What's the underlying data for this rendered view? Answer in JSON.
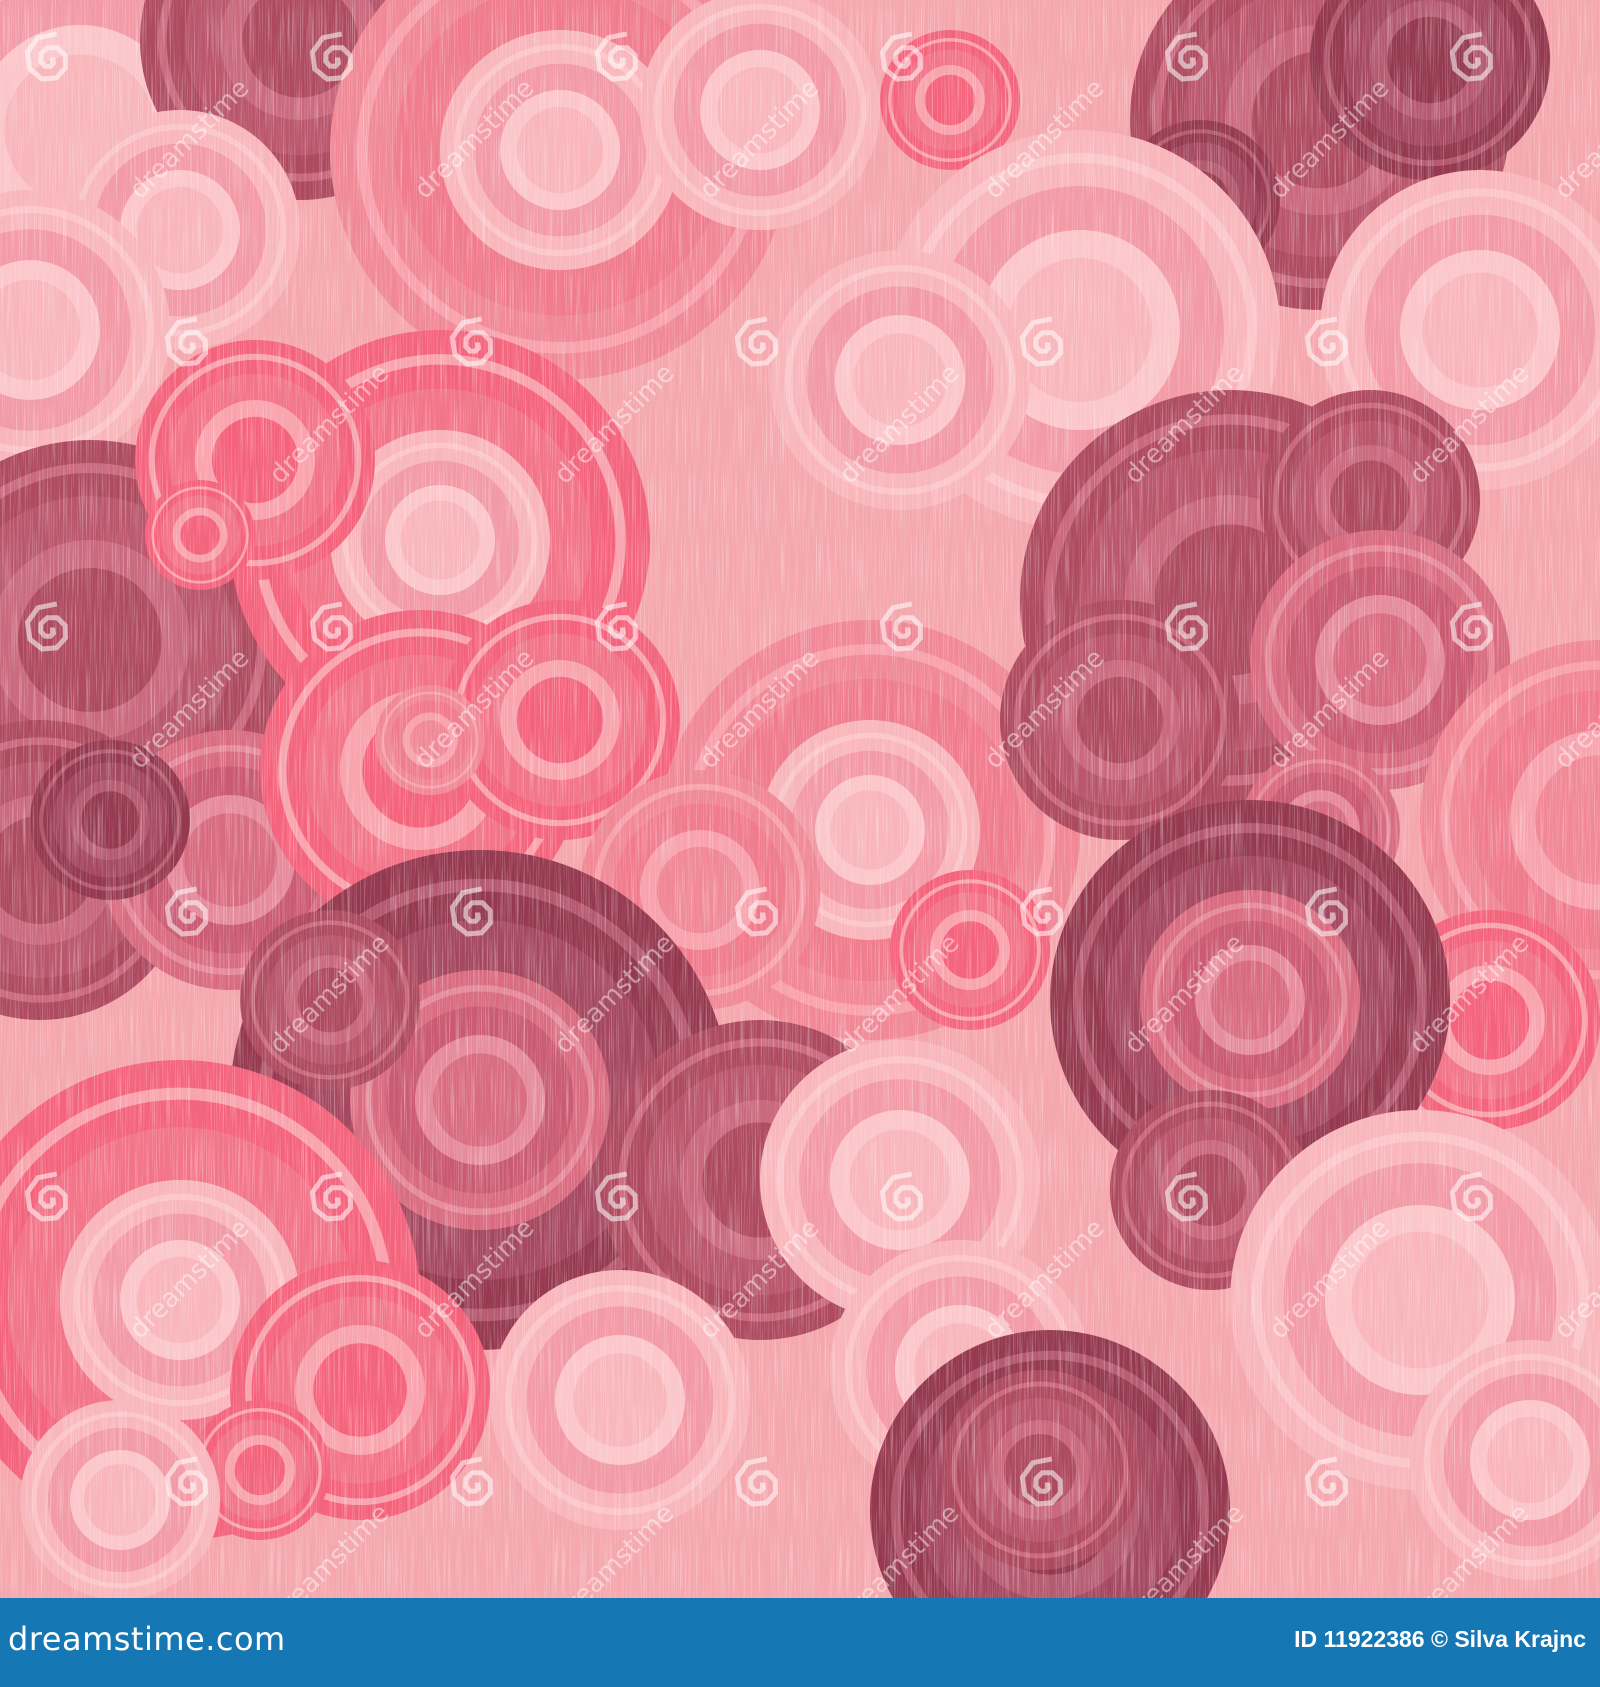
{
  "image": {
    "description_colors": {
      "background": "#f4a7ad",
      "light_pink": "#f8b6bb",
      "mid_pink": "#f08896",
      "hot_pink": "#f4637c",
      "dusty_rose": "#d86b7f",
      "wine": "#ad4a5f",
      "deep_wine": "#94394f"
    }
  },
  "watermark": {
    "text": "dreamstime",
    "icon": "swirl-icon"
  },
  "footer": {
    "brand": "dreamstime.com",
    "credit": "ID 11922386 © Silva Krajnc",
    "bar_color": "#1577b3"
  }
}
